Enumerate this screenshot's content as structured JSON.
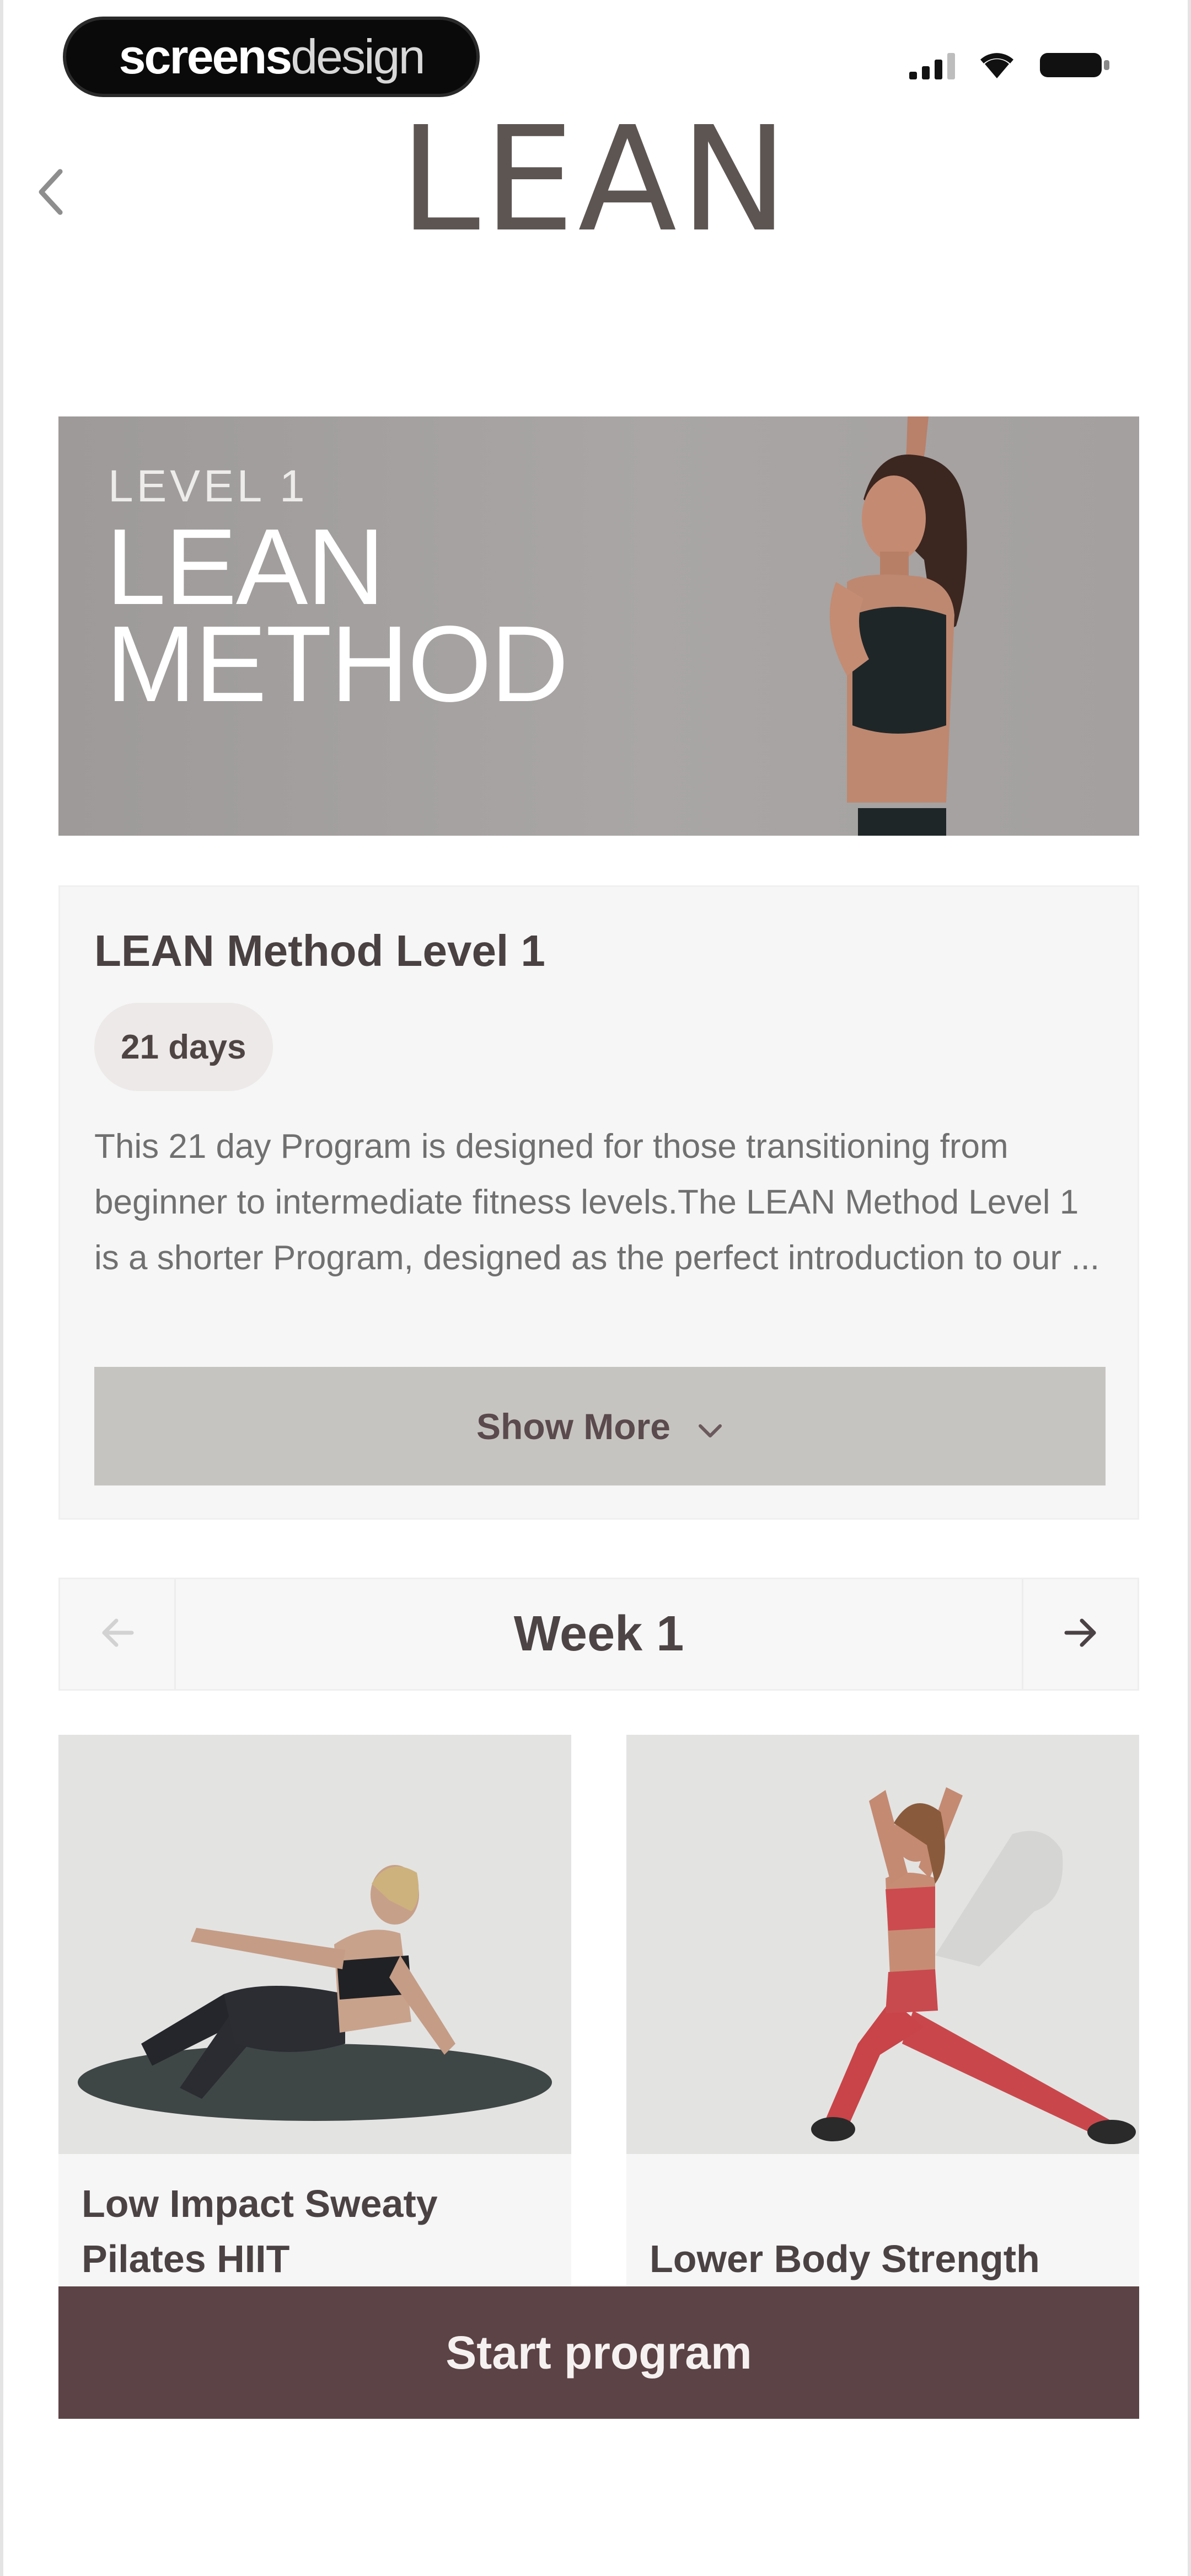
{
  "status_bar": {
    "watermark_bold": "screens",
    "watermark_thin": "design"
  },
  "header": {
    "logo": "LEAN"
  },
  "hero": {
    "level": "LEVEL 1",
    "title_line1": "LEAN",
    "title_line2": "METHOD"
  },
  "program": {
    "title": "LEAN Method Level 1",
    "duration_badge": "21 days",
    "description": "This 21 day Program is designed for those transitioning from beginner to intermediate fitness levels.The LEAN Method Level 1 is a shorter Program, designed as the perfect introduction to our ...",
    "show_more_label": "Show More"
  },
  "week_nav": {
    "label": "Week 1"
  },
  "workouts": [
    {
      "title": "Low Impact Sweaty Pilates HIIT"
    },
    {
      "title": "Lower Body Strength"
    }
  ],
  "cta": {
    "label": "Start program"
  },
  "colors": {
    "brand": "#5c4345",
    "logo": "#5d5552",
    "banner": "#a5a2a1",
    "show_more_bg": "#c6c4c1"
  },
  "icons": {
    "back": "chevron-left-icon",
    "show_more": "chevron-down-icon",
    "prev_week": "arrow-left-icon",
    "next_week": "arrow-right-icon",
    "signal": "cellular-signal-icon",
    "wifi": "wifi-icon",
    "battery": "battery-icon"
  }
}
